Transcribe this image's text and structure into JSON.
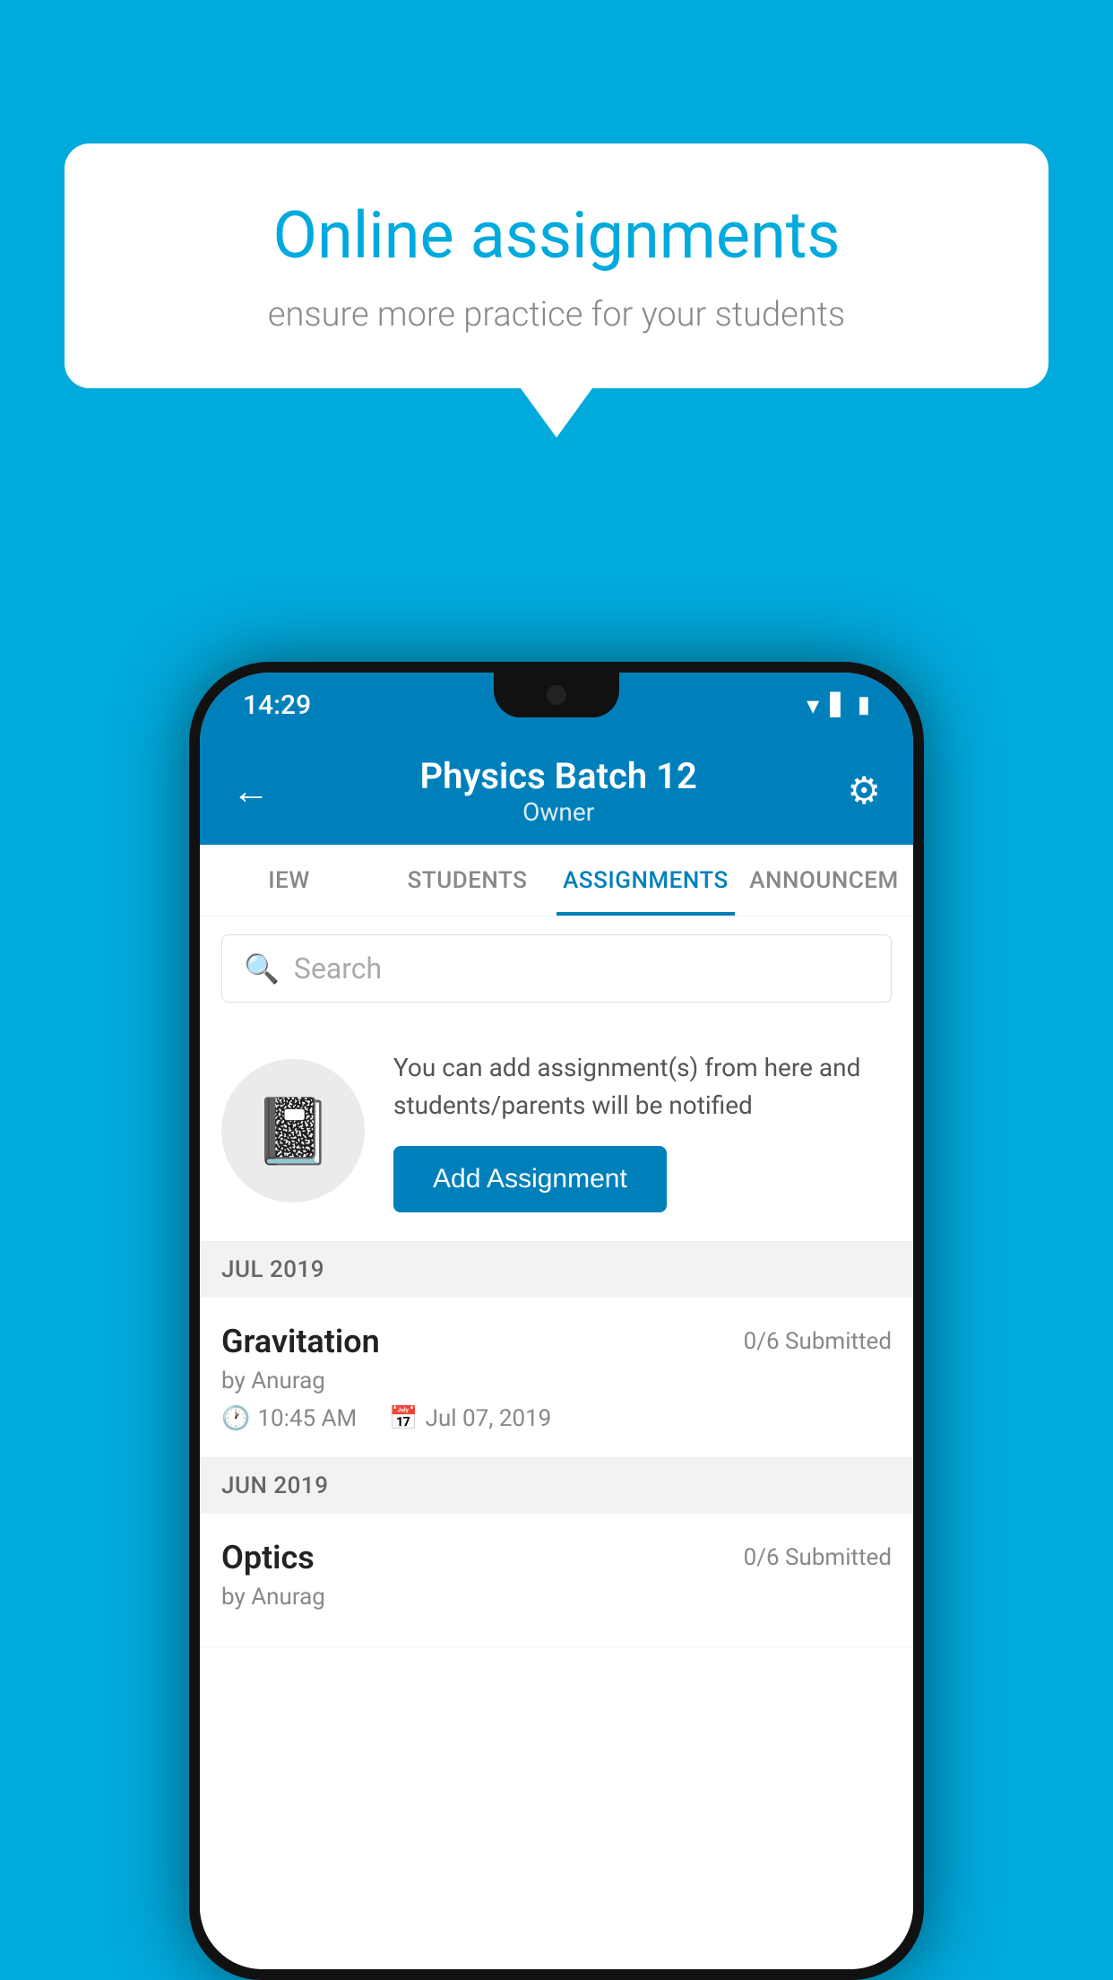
{
  "background": {
    "color": "#00AADD"
  },
  "hero_card": {
    "title": "Online assignments",
    "subtitle": "ensure more practice for your students"
  },
  "phone": {
    "status_bar": {
      "time": "14:29",
      "wifi": "▾",
      "signal": "▋▋",
      "battery": "▮"
    },
    "header": {
      "title": "Physics Batch 12",
      "subtitle": "Owner",
      "back_label": "←",
      "settings_label": "⚙"
    },
    "tabs": [
      {
        "label": "IEW",
        "active": false
      },
      {
        "label": "STUDENTS",
        "active": false
      },
      {
        "label": "ASSIGNMENTS",
        "active": true
      },
      {
        "label": "ANNOUNCEM",
        "active": false
      }
    ],
    "search": {
      "placeholder": "Search"
    },
    "add_assignment_section": {
      "description": "You can add assignment(s) from here and students/parents will be notified",
      "button_label": "Add Assignment"
    },
    "assignments": [
      {
        "month": "JUL 2019",
        "items": [
          {
            "name": "Gravitation",
            "submitted": "0/6 Submitted",
            "author": "by Anurag",
            "time": "10:45 AM",
            "date": "Jul 07, 2019"
          }
        ]
      },
      {
        "month": "JUN 2019",
        "items": [
          {
            "name": "Optics",
            "submitted": "0/6 Submitted",
            "author": "by Anurag",
            "time": "",
            "date": ""
          }
        ]
      }
    ]
  }
}
